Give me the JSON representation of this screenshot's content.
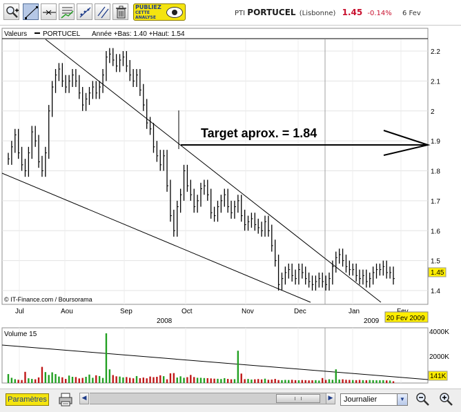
{
  "toolbar": {
    "tools": [
      {
        "name": "zoom-tool",
        "icon": "magnifier-plus-icon"
      },
      {
        "name": "trendline-tool",
        "icon": "trendline-icon"
      },
      {
        "name": "horizontal-line-tool",
        "icon": "horizontal-line-icon"
      },
      {
        "name": "channel-tool",
        "icon": "channel-icon"
      },
      {
        "name": "fibonacci-tool",
        "icon": "fibonacci-icon"
      },
      {
        "name": "parallel-lines-tool",
        "icon": "parallel-lines-icon"
      },
      {
        "name": "trash-tool",
        "icon": "trash-icon"
      }
    ],
    "ad": {
      "line1": "PUBLIEZ",
      "line2": "CETTE",
      "line3": "ANALYSE",
      "icon": "eye-icon"
    }
  },
  "quote": {
    "ticker": "PTI",
    "name": "PORTUCEL",
    "market": "(Lisbonne)",
    "price": "1.45",
    "change": "-0.14%",
    "date": "6 Fev"
  },
  "chart": {
    "legend_valeurs": "Valeurs",
    "legend_series": "PORTUCEL",
    "legend_stats": "Année +Bas: 1.40 +Haut: 1.54",
    "annotation": "Target aprox. = 1.84",
    "watermark": "© IT-Finance.com / Boursorama",
    "last_price_label": "1.45",
    "date_tag": "20 Fev 2009",
    "month_labels": [
      "Jul",
      "Aou",
      "Sep",
      "Oct",
      "Nov",
      "Dec",
      "Jan",
      "Fev"
    ],
    "year_labels": [
      "2008",
      "2009"
    ],
    "y_ticks": [
      "2.2",
      "2.1",
      "2",
      "1.9",
      "1.8",
      "1.7",
      "1.6",
      "1.5",
      "1.4"
    ],
    "up_color": "#22a022",
    "down_color": "#c01818",
    "accent_yellow": "#ffee00"
  },
  "volume": {
    "title": "Volume 15",
    "y_ticks": [
      "4000K",
      "2000K"
    ],
    "last_value": "141K"
  },
  "bottombar": {
    "params_label": "Paramètres",
    "period_value": "Journalier",
    "print_icon": "printer-icon",
    "zoom_out_icon": "magnifier-minus-icon",
    "zoom_in_icon": "magnifier-plus-icon",
    "scroll_left_icon": "arrow-left-icon",
    "scroll_right_icon": "arrow-right-icon",
    "dropdown_icon": "chevron-down-icon"
  },
  "chart_data": {
    "type": "bar",
    "title": "PTI PORTUCEL (Lisbonne)",
    "xlabel": "",
    "ylabel": "",
    "ylim": [
      1.35,
      2.25
    ],
    "x_ticks": [
      "Jul",
      "Aou",
      "Sep",
      "Oct",
      "Nov",
      "Dec",
      "Jan",
      "Fev"
    ],
    "series": [
      {
        "name": "PORTUCEL",
        "values": [
          1.84,
          1.88,
          1.92,
          1.86,
          1.82,
          1.8,
          1.86,
          1.93,
          1.9,
          1.83,
          1.8,
          1.86,
          2.0,
          2.08,
          2.12,
          2.14,
          2.1,
          2.08,
          2.1,
          2.12,
          2.1,
          2.06,
          2.02,
          2.04,
          2.06,
          2.08,
          2.06,
          2.08,
          2.12,
          2.18,
          2.19,
          2.17,
          2.15,
          2.17,
          2.18,
          2.15,
          2.12,
          2.1,
          2.12,
          2.07,
          2.02,
          1.96,
          1.94,
          1.88,
          1.85,
          1.82,
          1.85,
          1.75,
          1.65,
          1.6,
          1.68,
          1.72,
          1.8,
          1.75,
          1.72,
          1.68,
          1.7,
          1.74,
          1.75,
          1.72,
          1.66,
          1.65,
          1.68,
          1.7,
          1.72,
          1.68,
          1.66,
          1.68,
          1.7,
          1.65,
          1.62,
          1.63,
          1.64,
          1.62,
          1.61,
          1.6,
          1.63,
          1.6,
          1.55,
          1.5,
          1.42,
          1.44,
          1.46,
          1.47,
          1.45,
          1.44,
          1.47,
          1.46,
          1.44,
          1.43,
          1.42,
          1.43,
          1.44,
          1.43,
          1.42,
          1.44,
          1.48,
          1.51,
          1.52,
          1.5,
          1.48,
          1.47,
          1.47,
          1.45,
          1.44,
          1.45,
          1.43,
          1.44,
          1.46,
          1.47,
          1.47,
          1.48,
          1.46,
          1.46,
          1.44
        ]
      }
    ],
    "volume_values_k": [
      720,
      420,
      310,
      260,
      240,
      900,
      380,
      330,
      300,
      450,
      1300,
      880,
      650,
      860,
      720,
      520,
      460,
      330,
      600,
      500,
      480,
      370,
      410,
      500,
      680,
      420,
      620,
      560,
      410,
      4000,
      1100,
      640,
      540,
      520,
      450,
      480,
      420,
      380,
      560,
      390,
      440,
      380,
      520,
      470,
      500,
      620,
      550,
      300,
      780,
      800,
      440,
      540,
      420,
      470,
      650,
      480,
      420,
      420,
      400,
      390,
      370,
      350,
      340,
      320,
      390,
      330,
      300,
      310,
      2600,
      760,
      310,
      330,
      280,
      300,
      320,
      290,
      350,
      260,
      280,
      330,
      240,
      230,
      250,
      240,
      260,
      230,
      220,
      240,
      230,
      210,
      220,
      230,
      200,
      400,
      250,
      300,
      260,
      1100,
      280,
      300,
      260,
      250,
      240,
      230,
      250,
      230,
      220,
      240,
      230,
      220,
      220,
      230,
      210,
      200,
      141
    ]
  }
}
